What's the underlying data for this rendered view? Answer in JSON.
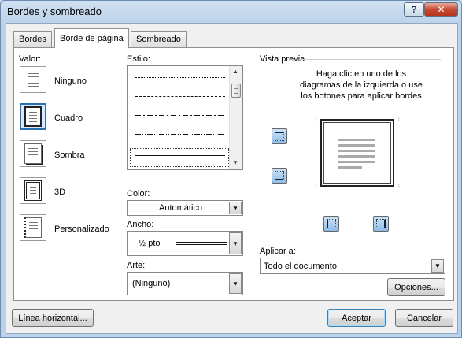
{
  "window": {
    "title": "Bordes y sombreado"
  },
  "titlebar": {
    "help_glyph": "?",
    "close_glyph": "✕"
  },
  "tabs": [
    {
      "label": "Bordes",
      "active": false
    },
    {
      "label": "Borde de página",
      "active": true
    },
    {
      "label": "Sombreado",
      "active": false
    }
  ],
  "valor": {
    "label": "Valor:",
    "options": [
      {
        "label": "Ninguno",
        "icon": "page-none-icon",
        "selected": false
      },
      {
        "label": "Cuadro",
        "icon": "page-box-icon",
        "selected": true
      },
      {
        "label": "Sombra",
        "icon": "page-shadow-icon",
        "selected": false
      },
      {
        "label": "3D",
        "icon": "page-3d-icon",
        "selected": false
      },
      {
        "label": "Personalizado",
        "icon": "page-custom-icon",
        "selected": false
      }
    ]
  },
  "estilo": {
    "label": "Estilo:",
    "styles": [
      "dotted",
      "dashed-short",
      "dash-dot",
      "dash-dot-dot",
      "double"
    ],
    "selected_index": 4
  },
  "color": {
    "label": "Color:",
    "value": "Automático"
  },
  "ancho": {
    "label": "Ancho:",
    "value": "½ pto"
  },
  "arte": {
    "label": "Arte:",
    "value": "(Ninguno)"
  },
  "preview": {
    "label": "Vista previa",
    "instructions": [
      "Haga clic en uno de los",
      "diagramas de la izquierda o use",
      "los botones para aplicar bordes"
    ],
    "border_buttons": [
      "top-border-icon",
      "bottom-border-icon",
      "left-border-icon",
      "right-border-icon"
    ]
  },
  "aplicar": {
    "label": "Aplicar a:",
    "value": "Todo el documento"
  },
  "buttons": {
    "opciones": "Opciones...",
    "linea_horizontal": "Línea horizontal...",
    "aceptar": "Aceptar",
    "cancelar": "Cancelar"
  },
  "colors": {
    "accent": "#2b6fb5",
    "close_red": "#c64a32"
  }
}
